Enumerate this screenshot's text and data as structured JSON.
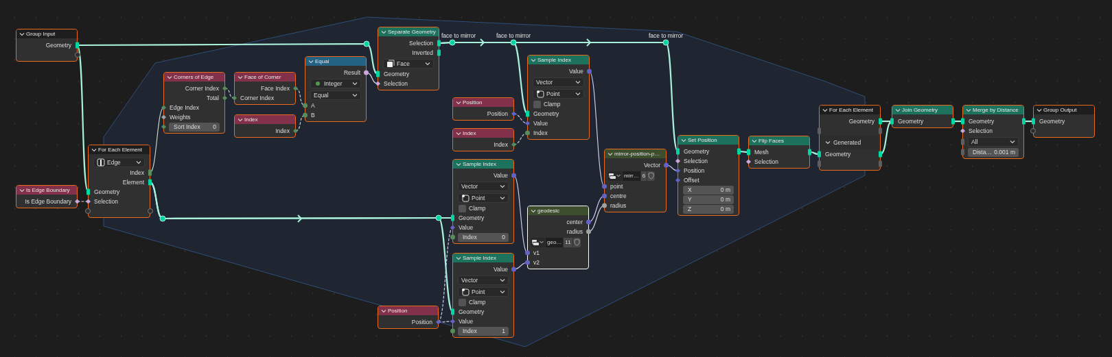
{
  "nodes": [
    {
      "title": "Group Input",
      "kind": "interface",
      "selected": true,
      "active": false,
      "rows": [
        {
          "kind": "socket",
          "label": "Geometry",
          "out": {
            "kind": "geometry"
          }
        },
        {
          "kind": "socket",
          "out": {
            "kind": "virtual"
          }
        }
      ]
    },
    {
      "title": "Is Edge Boundary",
      "kind": "input",
      "selected": true,
      "active": false,
      "rows": [
        {
          "kind": "socket",
          "label": "Is Edge Boundary",
          "out": {
            "kind": "boolfield"
          }
        }
      ]
    },
    {
      "title": "For Each Element",
      "kind": "zone",
      "selected": true,
      "active": false,
      "rows": [
        {
          "kind": "dropdown",
          "value": "Edge"
        },
        {
          "kind": "socket",
          "label": "Index",
          "out": {
            "kind": "intsquare"
          }
        },
        {
          "kind": "socket",
          "label": "Element",
          "out": {
            "kind": "geometry"
          }
        },
        {
          "kind": "socket",
          "label": "Geometry",
          "in": {
            "kind": "geometry"
          }
        },
        {
          "kind": "socket",
          "label": "Selection",
          "in": {
            "kind": "boolfield"
          }
        },
        {
          "kind": "socket",
          "in": {
            "kind": "virtual"
          },
          "out": {
            "kind": "virtual"
          }
        }
      ]
    },
    {
      "title": "Corners of Edge",
      "kind": "input",
      "selected": true,
      "active": false,
      "rows": [
        {
          "kind": "socket",
          "label": "Corner Index",
          "out": {
            "kind": "intfield"
          }
        },
        {
          "kind": "socket",
          "label": "Total",
          "out": {
            "kind": "intfield"
          }
        },
        {
          "kind": "socket",
          "label": "Edge Index",
          "in": {
            "kind": "intfield"
          }
        },
        {
          "kind": "socket",
          "label": "Weights",
          "in": {
            "kind": "floatfield"
          }
        },
        {
          "kind": "field",
          "label": "Sort Index",
          "value": "0",
          "in": {
            "kind": "intfield"
          }
        }
      ]
    },
    {
      "title": "Face of Corner",
      "kind": "input",
      "selected": true,
      "active": false,
      "rows": [
        {
          "kind": "socket",
          "label": "Face Index",
          "out": {
            "kind": "intfield"
          }
        },
        {
          "kind": "socket",
          "label": "Corner Index",
          "in": {
            "kind": "intfield"
          }
        }
      ]
    },
    {
      "title": "Index",
      "kind": "input",
      "selected": true,
      "active": false,
      "rows": [
        {
          "kind": "socket",
          "label": "Index",
          "out": {
            "kind": "intfield"
          }
        }
      ]
    },
    {
      "title": "Equal",
      "kind": "converter",
      "selected": true,
      "active": false,
      "rows": [
        {
          "kind": "socket",
          "label": "Result",
          "out": {
            "kind": "bool"
          }
        },
        {
          "kind": "dropdown",
          "value": "Integer"
        },
        {
          "kind": "dropdown",
          "value": "Equal"
        },
        {
          "kind": "socket",
          "label": "A",
          "in": {
            "kind": "int"
          }
        },
        {
          "kind": "socket",
          "label": "B",
          "in": {
            "kind": "int"
          }
        }
      ]
    },
    {
      "title": "Separate Geometry",
      "kind": "geometry",
      "selected": true,
      "active": false,
      "rows": [
        {
          "kind": "socket",
          "label": "Selection",
          "out": {
            "kind": "geometry"
          }
        },
        {
          "kind": "socket",
          "label": "Inverted",
          "out": {
            "kind": "geometry"
          }
        },
        {
          "kind": "dropdown",
          "value": "Face"
        },
        {
          "kind": "socket",
          "label": "Geometry",
          "in": {
            "kind": "geometry"
          }
        },
        {
          "kind": "socket",
          "label": "Selection",
          "in": {
            "kind": "boolfield"
          }
        }
      ]
    },
    {
      "title": "Position",
      "kind": "input",
      "selected": true,
      "active": false,
      "rows": [
        {
          "kind": "socket",
          "label": "Position",
          "out": {
            "kind": "vectorfield"
          }
        }
      ]
    },
    {
      "title": "Index",
      "kind": "input",
      "selected": true,
      "active": false,
      "rows": [
        {
          "kind": "socket",
          "label": "Index",
          "out": {
            "kind": "intfield"
          }
        }
      ]
    },
    {
      "title": "Sample Index",
      "kind": "geometry",
      "selected": true,
      "active": false,
      "rows": [
        {
          "kind": "socket",
          "label": "Value",
          "out": {
            "kind": "vector"
          }
        },
        {
          "kind": "dropdown",
          "value": "Vector"
        },
        {
          "kind": "dropdown",
          "value": "Point"
        },
        {
          "kind": "checkbox",
          "label": "Clamp",
          "checked": false
        },
        {
          "kind": "socket",
          "label": "Geometry",
          "in": {
            "kind": "geometry"
          }
        },
        {
          "kind": "socket",
          "label": "Value",
          "in": {
            "kind": "vectorfield"
          }
        },
        {
          "kind": "socket",
          "label": "Index",
          "in": {
            "kind": "int"
          }
        }
      ]
    },
    {
      "title": "Sample Index",
      "kind": "geometry",
      "selected": true,
      "active": false,
      "rows": [
        {
          "kind": "socket",
          "label": "Value",
          "out": {
            "kind": "vector"
          }
        },
        {
          "kind": "dropdown",
          "value": "Vector"
        },
        {
          "kind": "dropdown",
          "value": "Point"
        },
        {
          "kind": "checkbox",
          "label": "Clamp",
          "checked": false
        },
        {
          "kind": "socket",
          "label": "Geometry",
          "in": {
            "kind": "geometry"
          }
        },
        {
          "kind": "socket",
          "label": "Value",
          "in": {
            "kind": "vectorfield"
          }
        },
        {
          "kind": "field",
          "label": "Index",
          "value": "0",
          "in": {
            "kind": "int"
          }
        }
      ]
    },
    {
      "title": "Sample Index",
      "kind": "geometry",
      "selected": true,
      "active": false,
      "rows": [
        {
          "kind": "socket",
          "label": "Value",
          "out": {
            "kind": "vector"
          }
        },
        {
          "kind": "dropdown",
          "value": "Vector"
        },
        {
          "kind": "dropdown",
          "value": "Point"
        },
        {
          "kind": "checkbox",
          "label": "Clamp",
          "checked": false
        },
        {
          "kind": "socket",
          "label": "Geometry",
          "in": {
            "kind": "geometry"
          }
        },
        {
          "kind": "socket",
          "label": "Value",
          "in": {
            "kind": "vectorfield"
          }
        },
        {
          "kind": "field",
          "label": "Index",
          "value": "1",
          "in": {
            "kind": "int"
          }
        }
      ]
    },
    {
      "title": "Position",
      "kind": "input",
      "selected": true,
      "active": false,
      "rows": [
        {
          "kind": "socket",
          "label": "Position",
          "out": {
            "kind": "vectorfield"
          }
        }
      ]
    },
    {
      "title": "geodesic",
      "kind": "group",
      "selected": true,
      "active": true,
      "rows": [
        {
          "kind": "socket",
          "label": "center",
          "out": {
            "kind": "vector"
          }
        },
        {
          "kind": "socket",
          "label": "radius",
          "out": {
            "kind": "float"
          }
        },
        {
          "kind": "datablock",
          "value": "geo…",
          "users": "11"
        },
        {
          "kind": "socket",
          "label": "v1",
          "in": {
            "kind": "vector"
          }
        },
        {
          "kind": "socket",
          "label": "v2",
          "in": {
            "kind": "vector"
          }
        }
      ]
    },
    {
      "title": "mirror-position-p…",
      "kind": "group",
      "selected": true,
      "active": false,
      "rows": [
        {
          "kind": "socket",
          "label": "Vector",
          "out": {
            "kind": "vector"
          }
        },
        {
          "kind": "datablock",
          "value": "mirr…",
          "users": "6"
        },
        {
          "kind": "socket",
          "label": "point",
          "in": {
            "kind": "vector"
          }
        },
        {
          "kind": "socket",
          "label": "centre",
          "in": {
            "kind": "vector"
          }
        },
        {
          "kind": "socket",
          "label": "radius",
          "in": {
            "kind": "float"
          }
        }
      ]
    },
    {
      "title": "Set Position",
      "kind": "geometry",
      "selected": true,
      "active": false,
      "rows": [
        {
          "kind": "socket",
          "label": "Geometry",
          "in": {
            "kind": "geometry"
          },
          "out": {
            "kind": "geometry"
          }
        },
        {
          "kind": "socket",
          "label": "Selection",
          "in": {
            "kind": "boolfield"
          }
        },
        {
          "kind": "socket",
          "label": "Position",
          "in": {
            "kind": "vectorfield"
          }
        },
        {
          "kind": "socket",
          "label": "Offset",
          "in": {
            "kind": "vectorfield"
          }
        },
        {
          "kind": "field",
          "label": "X",
          "value": "0 m"
        },
        {
          "kind": "field",
          "label": "Y",
          "value": "0 m"
        },
        {
          "kind": "field",
          "label": "Z",
          "value": "0 m"
        }
      ]
    },
    {
      "title": "Flip Faces",
      "kind": "geometry",
      "selected": true,
      "active": false,
      "rows": [
        {
          "kind": "socket",
          "label": "Mesh",
          "in": {
            "kind": "geometry"
          },
          "out": {
            "kind": "geometry"
          }
        },
        {
          "kind": "socket",
          "label": "Selection",
          "in": {
            "kind": "boolfield"
          }
        }
      ]
    },
    {
      "title": "For Each Element",
      "kind": "zone",
      "selected": true,
      "active": false,
      "rows": [
        {
          "kind": "socket",
          "label": "Geometry",
          "out": {
            "kind": "geometry"
          }
        },
        {
          "kind": "socket",
          "in": {
            "kind": "empty"
          },
          "out": {
            "kind": "empty"
          }
        },
        {
          "kind": "panel",
          "label": "Generated"
        },
        {
          "kind": "socket",
          "label": "Geometry",
          "in": {
            "kind": "geometry"
          },
          "out": {
            "kind": "geometry"
          }
        },
        {
          "kind": "socket",
          "in": {
            "kind": "empty"
          },
          "out": {
            "kind": "empty"
          }
        }
      ]
    },
    {
      "title": "Join Geometry",
      "kind": "geometry",
      "selected": true,
      "active": false,
      "rows": [
        {
          "kind": "socket",
          "label": "Geometry",
          "in": {
            "kind": "geometry"
          },
          "out": {
            "kind": "geometry"
          }
        }
      ]
    },
    {
      "title": "Merge by Distance",
      "kind": "geometry",
      "selected": true,
      "active": false,
      "rows": [
        {
          "kind": "socket",
          "label": "Geometry",
          "in": {
            "kind": "geometry"
          },
          "out": {
            "kind": "geometry"
          }
        },
        {
          "kind": "socket",
          "label": "Selection",
          "in": {
            "kind": "boolfield"
          }
        },
        {
          "kind": "dropdown",
          "value": "All",
          "in": {
            "kind": "empty"
          }
        },
        {
          "kind": "field",
          "label": "Dista…",
          "value": "0.001 m",
          "in": {
            "kind": "empty"
          }
        }
      ]
    },
    {
      "title": "Group Output",
      "kind": "interface",
      "selected": true,
      "active": false,
      "rows": [
        {
          "kind": "socket",
          "label": "Geometry",
          "in": {
            "kind": "geometry"
          }
        },
        {
          "kind": "socket",
          "in": {
            "kind": "virtual"
          }
        }
      ]
    }
  ],
  "reroutes": [
    {
      "label": "face to mirror"
    },
    {
      "label": "face to mirror"
    },
    {
      "label": "face to mirror"
    }
  ]
}
